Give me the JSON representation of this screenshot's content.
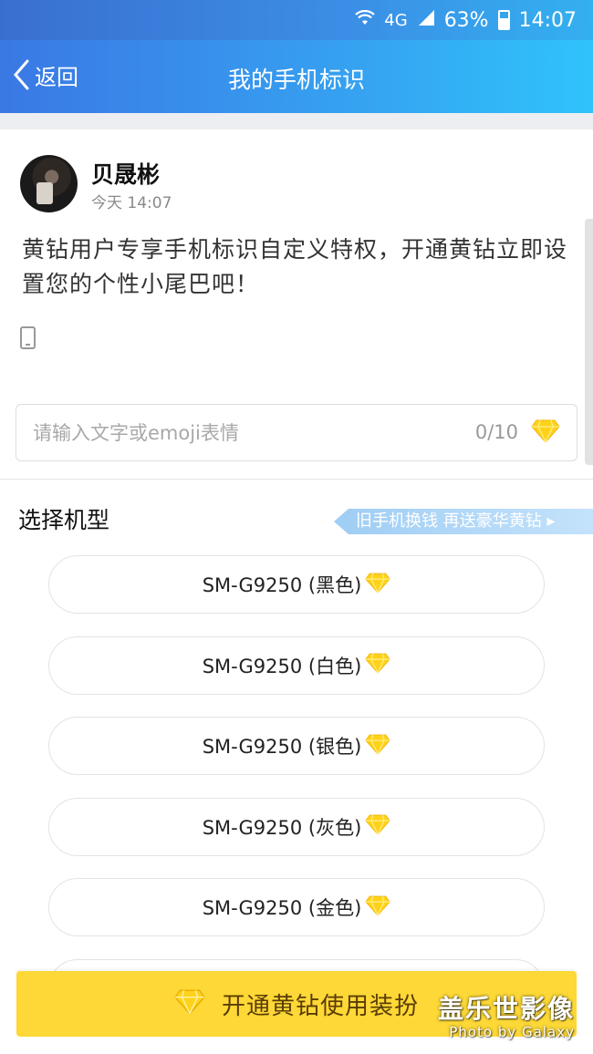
{
  "status_bar": {
    "network": "4G",
    "battery": "63%",
    "time": "14:07"
  },
  "nav": {
    "back_label": "返回",
    "title": "我的手机标识"
  },
  "post": {
    "user_name": "贝晟彬",
    "time": "今天 14:07",
    "text": "黄钻用户专享手机标识自定义特权，开通黄钻立即设置您的个性小尾巴吧！"
  },
  "tail_input": {
    "placeholder": "请输入文字或emoji表情",
    "value": "",
    "count": "0/10"
  },
  "select": {
    "title": "选择机型",
    "promo": "旧手机换钱 再送豪华黄钻 ▸",
    "models": [
      {
        "label": "SM-G9250 (黑色)"
      },
      {
        "label": "SM-G9250 (白色)"
      },
      {
        "label": "SM-G9250 (银色)"
      },
      {
        "label": "SM-G9250 (灰色)"
      },
      {
        "label": "SM-G9250 (金色)"
      }
    ]
  },
  "action": {
    "open_vip_label": "开通黄钻使用装扮"
  },
  "watermark": {
    "main": "盖乐世影像",
    "sub": "Photo by Galaxy"
  },
  "colors": {
    "accent_blue": "#36a2f1",
    "vip_yellow": "#fdd836",
    "gem_yellow": "#ffd21a"
  },
  "icons": [
    "wifi-icon",
    "signal-icon",
    "battery-icon",
    "back-chevron-icon",
    "device-icon",
    "diamond-icon"
  ]
}
